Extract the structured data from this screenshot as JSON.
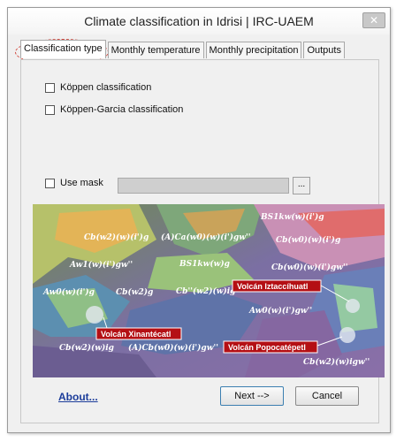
{
  "window": {
    "title": "Climate classification in Idrisi | IRC-UAEM",
    "close_glyph": "✕"
  },
  "tabs": [
    {
      "label": "Classification type",
      "active": true
    },
    {
      "label": "Monthly temperature",
      "active": false
    },
    {
      "label": "Monthly precipitation",
      "active": false
    },
    {
      "label": "Outputs",
      "active": false
    }
  ],
  "options": {
    "koppen_label": "Köppen classification",
    "koppen_garcia_label": "Köppen-Garcia classification",
    "use_mask_label": "Use mask",
    "browse_label": "..."
  },
  "map": {
    "climate_labels": [
      "BS1kw(w)(i')g",
      "Cb(w2)(w)(i')g",
      "(A)Ca(w0)(w)(i')gw''",
      "Cb(w0)(w)(i')g",
      "Aw1(w)(i')gw''",
      "BS1kw(w)g",
      "Cb(w0)(w)(i')gw''",
      "Aw0(w)(i')g",
      "Cb(w2)g",
      "Cb''(w2)(w)ig",
      "Aw0(w)(i')gw''",
      "Cb(w2)(w)ig",
      "(A)Cb(w0)(w)(i')gw''",
      "Cb(w2)(w)igw''"
    ],
    "volcano_labels": [
      "Volcán Iztaccíhuatl",
      "Volcán Xinantécatl",
      "Volcán Popocatépetl"
    ]
  },
  "footer": {
    "about_label": "About...",
    "next_label": "Next -->",
    "cancel_label": "Cancel"
  },
  "colors": {
    "accent_highlight": "#d0443a",
    "volcano_label_bg": "#b40f14",
    "link": "#1b3c9a"
  }
}
